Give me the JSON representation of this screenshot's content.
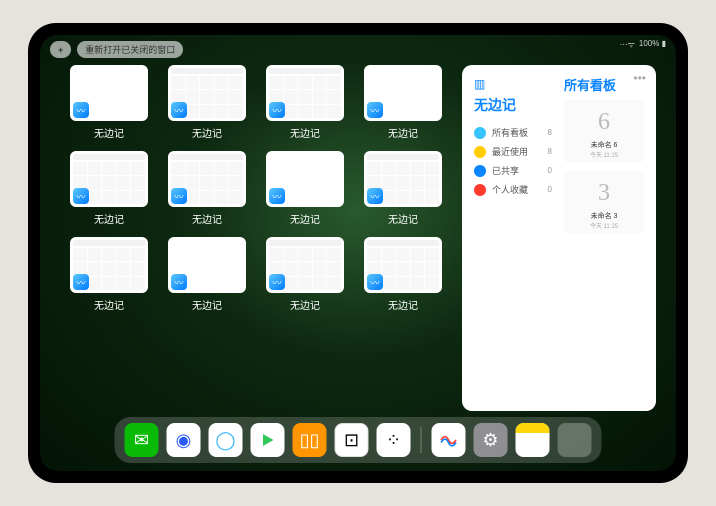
{
  "topbar": {
    "plus": "+",
    "reopen_label": "重新打开已关闭的窗口"
  },
  "status": {
    "wifi": "⋯ᯤ",
    "battery": "100% ▮"
  },
  "grid": {
    "app_icon_glyph": "〰",
    "items": [
      {
        "label": "无边记",
        "style": "blank"
      },
      {
        "label": "无边记",
        "style": "cal"
      },
      {
        "label": "无边记",
        "style": "cal"
      },
      {
        "label": "无边记",
        "style": "blank"
      },
      {
        "label": "无边记",
        "style": "cal"
      },
      {
        "label": "无边记",
        "style": "cal"
      },
      {
        "label": "无边记",
        "style": "blank"
      },
      {
        "label": "无边记",
        "style": "cal"
      },
      {
        "label": "无边记",
        "style": "cal"
      },
      {
        "label": "无边记",
        "style": "blank"
      },
      {
        "label": "无边记",
        "style": "cal"
      },
      {
        "label": "无边记",
        "style": "cal"
      }
    ]
  },
  "panel": {
    "more": "•••",
    "title": "无边记",
    "all_boards_title": "所有看板",
    "sidebar": [
      {
        "icon_color": "#34c3ff",
        "label": "所有看板",
        "count": "8"
      },
      {
        "icon_color": "#ffcc00",
        "label": "最近使用",
        "count": "8"
      },
      {
        "icon_color": "#0a84ff",
        "label": "已共享",
        "count": "0"
      },
      {
        "icon_color": "#ff3b30",
        "label": "个人收藏",
        "count": "0"
      }
    ],
    "boards": [
      {
        "sketch": "6",
        "name": "未命名 6",
        "date": "今天 11:25"
      },
      {
        "sketch": "3",
        "name": "未命名 3",
        "date": "今天 11:25"
      }
    ]
  },
  "dock": {
    "icons": [
      {
        "name": "wechat-icon",
        "glyph": "✉"
      },
      {
        "name": "quark-icon",
        "glyph": "◉"
      },
      {
        "name": "qq-browser-icon",
        "glyph": "◯"
      },
      {
        "name": "play-icon",
        "glyph": "▶"
      },
      {
        "name": "books-icon",
        "glyph": "▯▯"
      },
      {
        "name": "game-icon",
        "glyph": "⊡"
      },
      {
        "name": "grid-app-icon",
        "glyph": "⁘"
      },
      {
        "name": "freeform-icon",
        "glyph": "〰"
      },
      {
        "name": "settings-icon",
        "glyph": "⚙"
      },
      {
        "name": "notes-icon",
        "glyph": ""
      }
    ]
  }
}
